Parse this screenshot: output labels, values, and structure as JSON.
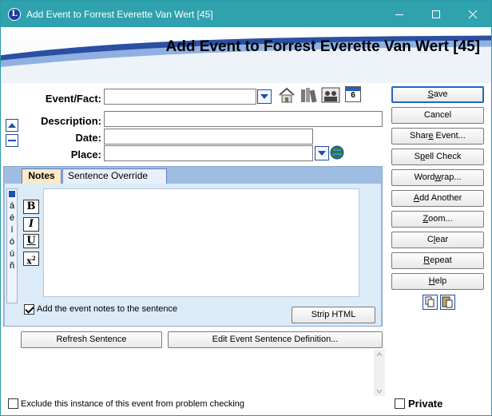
{
  "window": {
    "title": "Add Event to Forrest Everette Van Wert [45]",
    "app_icon_letter": "L"
  },
  "header": {
    "title": "Add Event to Forrest Everette Van Wert [45]"
  },
  "form": {
    "event_label": "Event/Fact:",
    "event_value": "",
    "description_label": "Description:",
    "description_value": "",
    "date_label": "Date:",
    "date_value": "",
    "place_label": "Place:",
    "place_value": ""
  },
  "tools": {
    "calendar_number": "6"
  },
  "tabs": {
    "notes": "Notes",
    "sentence_override": "Sentence Override"
  },
  "notes": {
    "accents": [
      "á",
      "é",
      "í",
      "ó",
      "ú",
      "ñ"
    ],
    "bold": "B",
    "italic": "I",
    "underline": "U",
    "superscript": "x",
    "superscript_exp": "2",
    "text": "",
    "add_to_sentence_label": "Add the event notes to the sentence",
    "add_to_sentence_checked": true,
    "strip_html": "Strip HTML"
  },
  "buttons": {
    "refresh_sentence": "Refresh Sentence",
    "edit_sentence": "Edit Event Sentence Definition..."
  },
  "side_buttons": {
    "save_u": "S",
    "save_rest": "ave",
    "cancel": "Cancel",
    "share_pre": "Shar",
    "share_u": "e",
    "share_rest": " Event...",
    "spell_pre": "S",
    "spell_u": "p",
    "spell_rest": "ell Check",
    "wordwrap_pre": "Word",
    "wordwrap_u": "w",
    "wordwrap_rest": "rap...",
    "add_u": "A",
    "add_rest": "dd Another",
    "zoom_u": "Z",
    "zoom_rest": "oom...",
    "clear_pre": "C",
    "clear_u": "l",
    "clear_rest": "ear",
    "repeat_u": "R",
    "repeat_rest": "epeat",
    "help_u": "H",
    "help_rest": "elp"
  },
  "footer": {
    "exclude_label": "Exclude this instance of this event from problem checking",
    "exclude_checked": false,
    "private_label": "Private",
    "private_checked": false
  },
  "colors": {
    "titlebar": "#2fa2ae",
    "accent_blue": "#1f4fa8",
    "notes_panel": "#9fbde3"
  }
}
